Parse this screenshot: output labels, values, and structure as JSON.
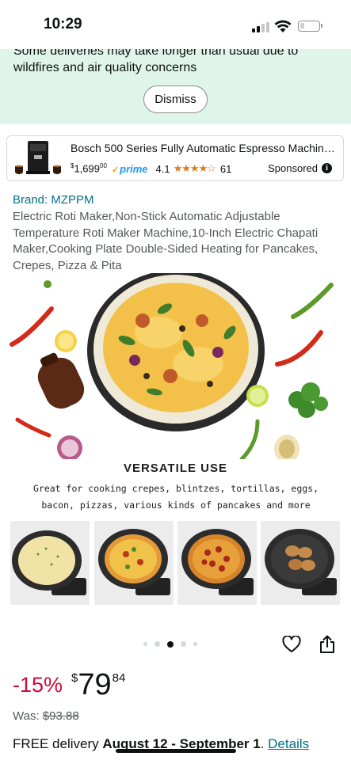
{
  "status_bar": {
    "time": "10:29",
    "icons": [
      "cellular-signal-icon",
      "wifi-icon",
      "battery-icon"
    ]
  },
  "notice": {
    "text": "Some deliveries may take longer than usual due to wildfires and air quality concerns",
    "dismiss_label": "Dismiss"
  },
  "sponsored_ad": {
    "title": "Bosch 500 Series Fully Automatic Espresso Machine...",
    "price_whole": "1,699",
    "price_fraction": "00",
    "price_symbol": "$",
    "prime_label": "prime",
    "rating": "4.1",
    "stars": "★★★★☆",
    "review_count": "61",
    "sponsored_label": "Sponsored",
    "icons": [
      "espresso-machine-thumbnail",
      "info-icon"
    ]
  },
  "product": {
    "brand": "Brand: MZPPM",
    "title": "Electric Roti Maker,Non-Stick Automatic Adjustable Temperature Roti Maker Machine,10-Inch Electric Chapati Maker,Cooking Plate Double-Sided Heating for Pancakes, Crepes, Pizza & Pita"
  },
  "hero_image": {
    "heading": "VERSATILE USE",
    "description": "Great for cooking crepes, blintzes, tortillas, eggs, bacon, pizzas, various kinds of pancakes  and more"
  },
  "gallery": {
    "thumbnails": [
      "crepe-thumbnail",
      "pizza-thumbnail",
      "pepperoni-pizza-thumbnail",
      "pancakes-thumbnail"
    ],
    "page_count": 5,
    "active_page": 3
  },
  "actions": {
    "icons": [
      "heart-icon",
      "share-icon"
    ]
  },
  "pricing": {
    "discount": "-15%",
    "symbol": "$",
    "whole": "79",
    "fraction": "84",
    "was_label": "Was: ",
    "was_price": "$93.88"
  },
  "delivery": {
    "prefix": "FREE delivery ",
    "dates": "August 12 - September 1",
    "separator": ". ",
    "details_link": "Details"
  },
  "colors": {
    "link": "#007185",
    "discount": "#cc0c39",
    "notice_bg": "#dff5ec",
    "star": "#de7921",
    "prime": "#1a98ff"
  }
}
